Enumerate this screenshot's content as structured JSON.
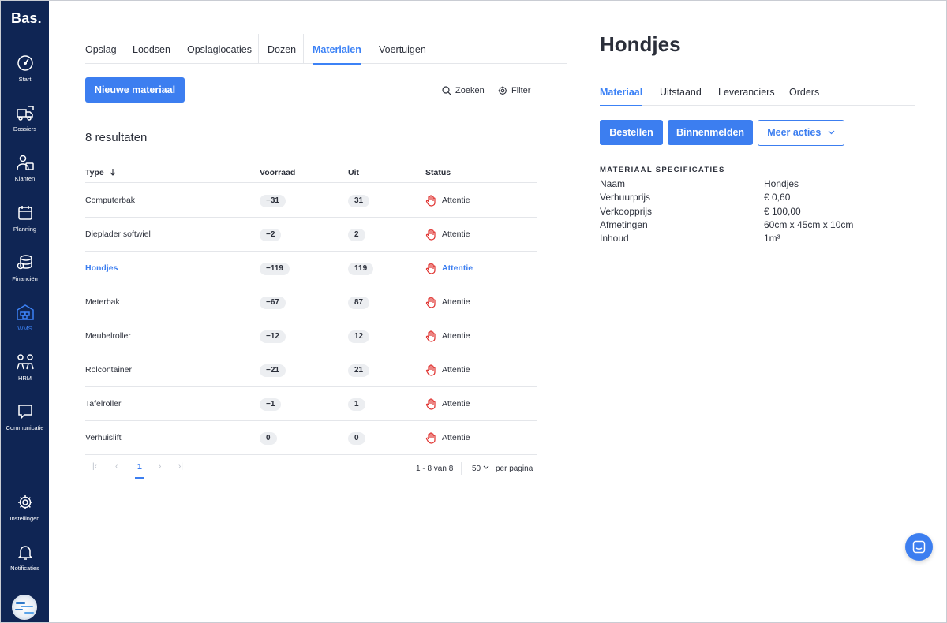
{
  "app": {
    "logo": "Bas",
    "logo_dot": "."
  },
  "sidebar": {
    "items": [
      {
        "label": "Start",
        "icon": "gauge-icon"
      },
      {
        "label": "Dossiers",
        "icon": "truck-icon"
      },
      {
        "label": "Klanten",
        "icon": "customers-icon"
      },
      {
        "label": "Planning",
        "icon": "calendar-icon"
      },
      {
        "label": "Financiën",
        "icon": "coins-icon"
      },
      {
        "label": "WMS",
        "icon": "warehouse-icon",
        "active": true
      },
      {
        "label": "HRM",
        "icon": "people-icon"
      },
      {
        "label": "Communicatie",
        "icon": "chat-bubble-icon"
      },
      {
        "label": "Instellingen",
        "icon": "gear-icon"
      },
      {
        "label": "Notificaties",
        "icon": "bell-icon"
      }
    ]
  },
  "main": {
    "tabs": [
      "Opslag",
      "Loodsen",
      "Opslaglocaties",
      "Dozen",
      "Materialen",
      "Voertuigen"
    ],
    "active_tab": "Materialen",
    "new_button": "Nieuwe materiaal",
    "search_label": "Zoeken",
    "filter_label": "Filter",
    "result_count": "8 resultaten",
    "columns": {
      "type": "Type",
      "voorraad": "Voorraad",
      "uit": "Uit",
      "status": "Status"
    },
    "rows": [
      {
        "name": "Computerbak",
        "voorraad": "−31",
        "uit": "31",
        "status": "Attentie"
      },
      {
        "name": "Dieplader softwiel",
        "voorraad": "−2",
        "uit": "2",
        "status": "Attentie"
      },
      {
        "name": "Hondjes",
        "voorraad": "−119",
        "uit": "119",
        "status": "Attentie",
        "selected": true
      },
      {
        "name": "Meterbak",
        "voorraad": "−67",
        "uit": "87",
        "status": "Attentie"
      },
      {
        "name": "Meubelroller",
        "voorraad": "−12",
        "uit": "12",
        "status": "Attentie"
      },
      {
        "name": "Rolcontainer",
        "voorraad": "−21",
        "uit": "21",
        "status": "Attentie"
      },
      {
        "name": "Tafelroller",
        "voorraad": "−1",
        "uit": "1",
        "status": "Attentie"
      },
      {
        "name": "Verhuislift",
        "voorraad": "0",
        "uit": "0",
        "status": "Attentie"
      }
    ],
    "pagination": {
      "current_page": "1",
      "range": "1 - 8 van 8",
      "page_size": "50",
      "per_page_label": "per pagina"
    }
  },
  "detail": {
    "title": "Hondjes",
    "tabs": [
      "Materiaal",
      "Uitstaand",
      "Leveranciers",
      "Orders"
    ],
    "active_tab": "Materiaal",
    "actions": {
      "order": "Bestellen",
      "check_in": "Binnenmelden",
      "more": "Meer acties"
    },
    "spec_title": "MATERIAAL SPECIFICATIES",
    "specs": [
      {
        "key": "Naam",
        "value": "Hondjes"
      },
      {
        "key": "Verhuurprijs",
        "value": "€ 0,60"
      },
      {
        "key": "Verkoopprijs",
        "value": "€ 100,00"
      },
      {
        "key": "Afmetingen",
        "value": "60cm x 45cm x 10cm"
      },
      {
        "key": "Inhoud",
        "value": "1m³"
      }
    ]
  },
  "colors": {
    "sidebar": "#0f2554",
    "accent": "#3c7ef0",
    "status_attention": "#e0322f"
  }
}
